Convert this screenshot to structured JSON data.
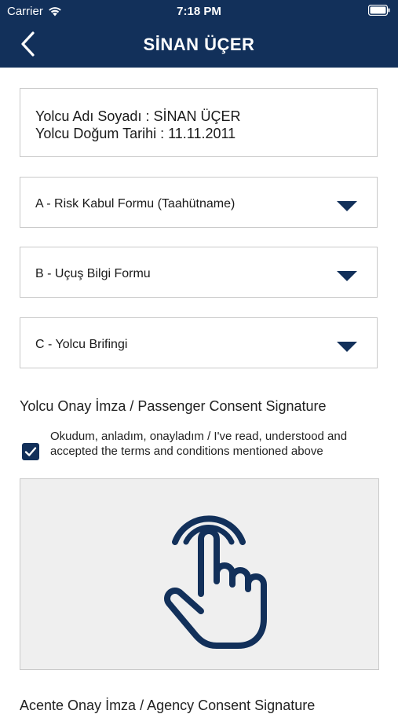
{
  "status_bar": {
    "carrier": "Carrier",
    "time": "7:18 PM"
  },
  "nav": {
    "title": "SİNAN ÜÇER"
  },
  "passenger_info": {
    "name_line": "Yolcu Adı Soyadı : SİNAN ÜÇER",
    "birth_line": "Yolcu Doğum Tarihi : 11.11.2011"
  },
  "forms": [
    {
      "label": "A - Risk Kabul Formu (Taahütname)"
    },
    {
      "label": "B - Uçuş Bilgi Formu"
    },
    {
      "label": "C - Yolcu Brifingi"
    }
  ],
  "passenger_signature": {
    "title": "Yolcu Onay İmza / Passenger Consent Signature",
    "checkbox_checked": true,
    "consent_text": "Okudum, anladım, onayladım / I've read, understood and accepted the terms and conditions mentioned above"
  },
  "agency_signature": {
    "title": "Acente Onay İmza / Agency Consent Signature"
  },
  "colors": {
    "primary": "#12305a",
    "pad_background": "#efefef"
  }
}
